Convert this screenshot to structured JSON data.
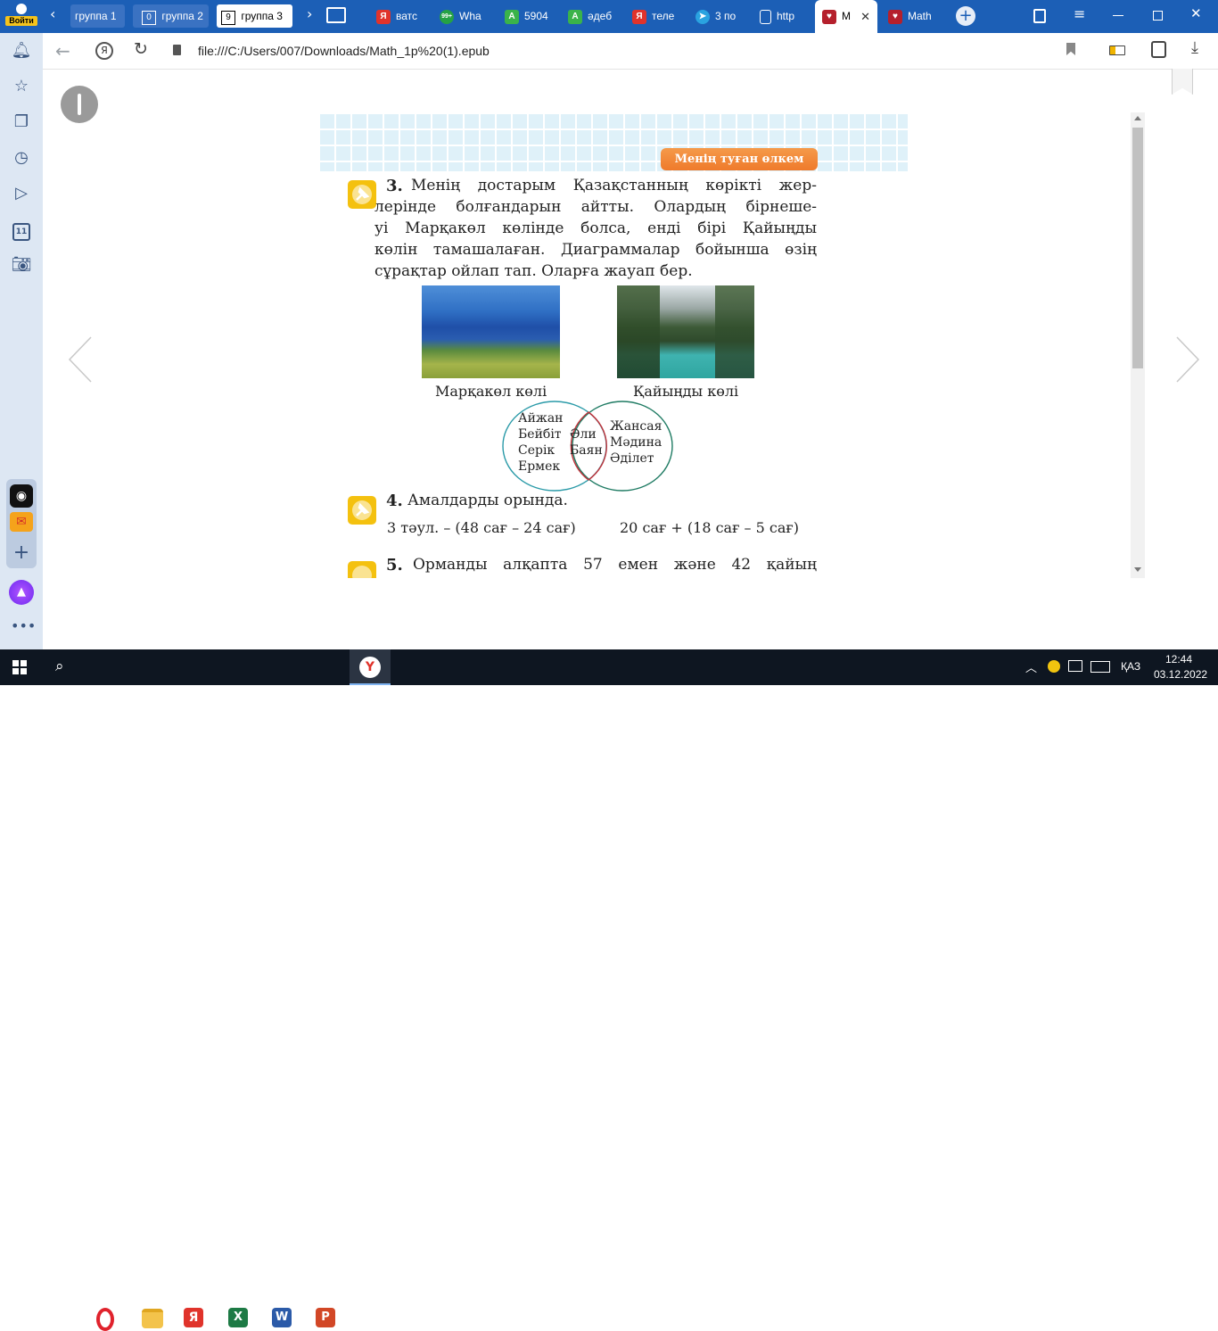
{
  "browser": {
    "login_label": "Войти",
    "tab_groups": [
      "группа 1",
      "группа 2",
      "группа 3"
    ],
    "tab_group_counts": [
      "",
      "0",
      "9"
    ],
    "tabs": [
      {
        "label": "ватс",
        "color": "#e0332b",
        "glyph": "Я"
      },
      {
        "label": "Wha",
        "color": "#25a244",
        "glyph": "99+"
      },
      {
        "label": "5904",
        "color": "#3ab34a",
        "glyph": "A"
      },
      {
        "label": "әдеб",
        "color": "#3ab34a",
        "glyph": "A"
      },
      {
        "label": "теле",
        "color": "#e0332b",
        "glyph": "Я"
      },
      {
        "label": "3 по",
        "color": "#2aa3e0",
        "glyph": "➤"
      },
      {
        "label": "http",
        "color": "#ffffff",
        "glyph": "▢"
      },
      {
        "label": "M",
        "color": "#b5202c",
        "glyph": "♥"
      },
      {
        "label": "Math",
        "color": "#b5202c",
        "glyph": "♥"
      }
    ],
    "url": "file:///C:/Users/007/Downloads/Math_1p%20(1).epub",
    "sidebar_badge": "11"
  },
  "book": {
    "banner": "Менің туған өлкем",
    "task3_number": "3.",
    "task3_lines": [
      "Менің достарым Қазақстанның көрікті жер-",
      "лерінде болғандарын айтты. Олардың бірнеше-",
      "уі Марқакөл көлінде болса, енді бірі Қайыңды",
      "көлін тамашалаған. Диаграммалар бойынша өзің",
      "сұрақтар ойлап тап. Оларға жауап бер."
    ],
    "photo1_caption": "Марқакөл көлі",
    "photo2_caption": "Қайыңды көлі",
    "venn_left": [
      "Айжан",
      "Бейбіт",
      "Серік",
      "Ермек"
    ],
    "venn_middle": [
      "Әли",
      "Баян"
    ],
    "venn_right": [
      "Жансая",
      "Мәдина",
      "Әділет"
    ],
    "task4_number": "4.",
    "task4_text": "Амалдарды орында.",
    "task4_expr1": "3 тәул. – (48 сағ – 24 сағ)",
    "task4_expr2": "20 сағ + (18 сағ – 5 сағ)",
    "task5_number": "5.",
    "task5_text": "Орманды алқапта 57 емен және 42 қайың"
  },
  "taskbar": {
    "language": "ҚАЗ",
    "time": "12:44",
    "date": "03.12.2022"
  }
}
